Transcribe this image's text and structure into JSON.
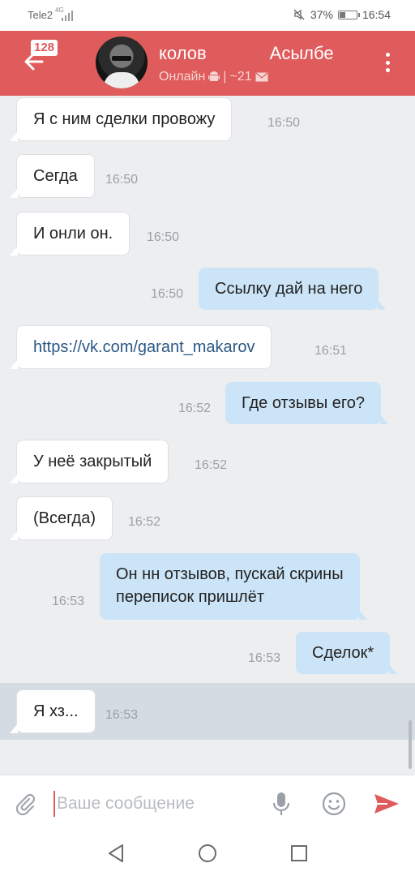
{
  "status_bar": {
    "carrier": "Tele2",
    "network": "4G",
    "battery": "37%",
    "battery_level": 0.37,
    "time": "16:54"
  },
  "header": {
    "unread_count": "128",
    "name_first": "колов",
    "name_last": "Асылбе",
    "status": "Онлайн",
    "separator": "|",
    "age": "~21"
  },
  "messages": [
    {
      "dir": "in",
      "text": "Я с ним сделки провожу",
      "time": "16:50"
    },
    {
      "dir": "in",
      "text": "Сегда",
      "time": "16:50"
    },
    {
      "dir": "in",
      "text": "И онли он.",
      "time": "16:50"
    },
    {
      "dir": "out",
      "text": "Ссылку дай на него",
      "time": "16:50"
    },
    {
      "dir": "in",
      "text": "https://vk.com/garant_makarov",
      "time": "16:51"
    },
    {
      "dir": "out",
      "text": "Где отзывы его?",
      "time": "16:52"
    },
    {
      "dir": "in",
      "text": "У неё закрытый",
      "time": "16:52"
    },
    {
      "dir": "in",
      "text": "(Всегда)",
      "time": "16:52"
    },
    {
      "dir": "out",
      "text_line1": "Он нн отзывов, пускай скрины",
      "text_line2": "переписок пришлёт",
      "time": "16:53"
    },
    {
      "dir": "out",
      "text": "Сделок*",
      "time": "16:53"
    },
    {
      "dir": "in",
      "text": "Я хз...",
      "time": "16:53"
    }
  ],
  "composer": {
    "placeholder": "Ваше сообщение"
  },
  "icons": {
    "back": "arrow-left-icon",
    "menu": "more-vertical-icon",
    "attach": "paperclip-icon",
    "mic": "microphone-icon",
    "emoji": "smile-icon",
    "send": "send-icon",
    "android": "android-icon",
    "mail": "envelope-icon"
  },
  "colors": {
    "header": "#e05b5b",
    "chat_bg": "#edeef0",
    "outgoing_bubble": "#cce4f7",
    "incoming_bubble": "#ffffff",
    "link": "#2a5885"
  }
}
